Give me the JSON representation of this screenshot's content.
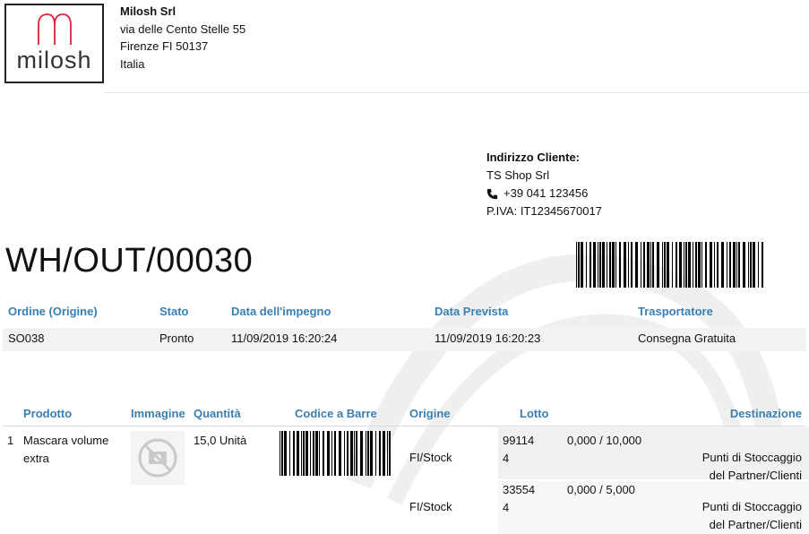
{
  "company": {
    "logo_text": "milosh",
    "name": "Milosh Srl",
    "address_line1": "via delle Cento Stelle 55",
    "address_line2": "Firenze FI 50137",
    "country": "Italia"
  },
  "customer": {
    "label": "Indirizzo Cliente:",
    "name": "TS Shop Srl",
    "phone": "+39 041 123456",
    "vat": "P.IVA: IT12345670017"
  },
  "document": {
    "title": "WH/OUT/00030"
  },
  "info": {
    "headers": [
      "Ordine (Origine)",
      "Stato",
      "Data dell'impegno",
      "Data Prevista",
      "Trasportatore"
    ],
    "values": [
      "SO038",
      "Pronto",
      "11/09/2019 16:20:24",
      "11/09/2019 16:20:23",
      "Consegna Gratuita"
    ]
  },
  "products": {
    "headers": [
      "Prodotto",
      "Immagine",
      "Quantità",
      "Codice a Barre",
      "Origine",
      "Lotto",
      "Destinazione"
    ],
    "rows": [
      {
        "index": "1",
        "name_line1": "Mascara volume",
        "name_line2": "extra",
        "quantity": "15,0 Unità",
        "image_icon": "no-photo-icon",
        "lines": [
          {
            "origin": "FI/Stock",
            "lot_line1": "99114",
            "lot_line2": "4",
            "qty": "0,000 / 10,000",
            "dest_line1": "Punti di Stoccaggio",
            "dest_line2": "del Partner/Clienti"
          },
          {
            "origin": "FI/Stock",
            "lot_line1": "33554",
            "lot_line2": "4",
            "qty": "0,000 / 5,000",
            "dest_line1": "Punti di Stoccaggio",
            "dest_line2": "del Partner/Clienti"
          }
        ]
      }
    ]
  },
  "colors": {
    "header_blue": "#3a7fb0",
    "logo_red": "#d9243c",
    "band_grey": "#f2f2f2"
  }
}
